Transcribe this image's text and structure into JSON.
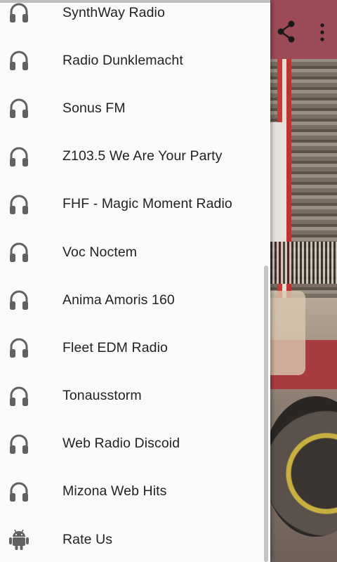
{
  "drawer": {
    "items": [
      {
        "label": "SynthWay Radio",
        "icon": "headphones-icon"
      },
      {
        "label": "Radio Dunklemacht",
        "icon": "headphones-icon"
      },
      {
        "label": "Sonus FM",
        "icon": "headphones-icon"
      },
      {
        "label": "Z103.5 We Are Your Party",
        "icon": "headphones-icon"
      },
      {
        "label": "FHF - Magic Moment Radio",
        "icon": "headphones-icon"
      },
      {
        "label": "Voc Noctem",
        "icon": "headphones-icon"
      },
      {
        "label": "Anima Amoris 160",
        "icon": "headphones-icon"
      },
      {
        "label": "Fleet EDM Radio",
        "icon": "headphones-icon"
      },
      {
        "label": "Tonausstorm",
        "icon": "headphones-icon"
      },
      {
        "label": "Web Radio Discoid",
        "icon": "headphones-icon"
      },
      {
        "label": "Mizona Web Hits",
        "icon": "headphones-icon"
      },
      {
        "label": "Rate Us",
        "icon": "android-icon"
      }
    ]
  },
  "toolbar": {
    "actions": [
      "share-icon",
      "more-vert-icon"
    ]
  },
  "colors": {
    "toolbar": "#9c4a55",
    "drawer_bg": "#fafafa",
    "label_text": "#222222",
    "icon_gray": "#616161"
  }
}
